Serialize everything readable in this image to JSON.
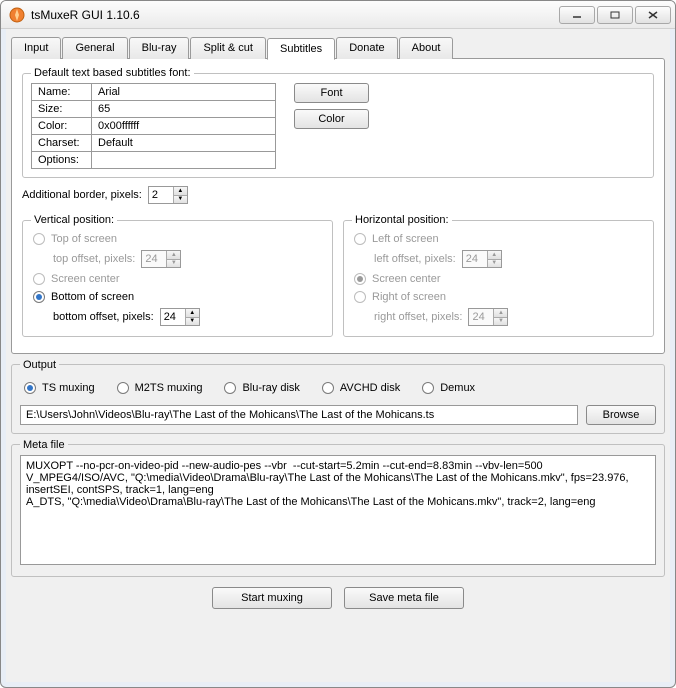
{
  "window": {
    "title": "tsMuxeR GUI 1.10.6"
  },
  "tabs": {
    "input": "Input",
    "general": "General",
    "bluray": "Blu-ray",
    "split": "Split & cut",
    "subtitles": "Subtitles",
    "donate": "Donate",
    "about": "About"
  },
  "subtitles": {
    "fieldset_label": "Default text based subtitles font:",
    "font_keys": {
      "name": "Name:",
      "size": "Size:",
      "color": "Color:",
      "charset": "Charset:",
      "options": "Options:"
    },
    "font_vals": {
      "name": "Arial",
      "size": "65",
      "color": "0x00ffffff",
      "charset": "Default",
      "options": ""
    },
    "btn_font": "Font",
    "btn_color": "Color",
    "add_border_label": "Additional border, pixels:",
    "add_border_val": "2",
    "vpos": {
      "legend": "Vertical position:",
      "top": "Top of screen",
      "top_off_lbl": "top offset, pixels:",
      "top_off_val": "24",
      "center": "Screen center",
      "bottom": "Bottom of screen",
      "bot_off_lbl": "bottom offset, pixels:",
      "bot_off_val": "24"
    },
    "hpos": {
      "legend": "Horizontal position:",
      "left": "Left of screen",
      "left_off_lbl": "left offset, pixels:",
      "left_off_val": "24",
      "center": "Screen center",
      "right": "Right of screen",
      "right_off_lbl": "right offset, pixels:",
      "right_off_val": "24"
    }
  },
  "output": {
    "legend": "Output",
    "opts": {
      "ts": "TS muxing",
      "m2ts": "M2TS muxing",
      "bluray": "Blu-ray disk",
      "avchd": "AVCHD disk",
      "demux": "Demux"
    },
    "path": "E:\\Users\\John\\Videos\\Blu-ray\\The Last of the Mohicans\\The Last of the Mohicans.ts",
    "browse": "Browse"
  },
  "meta": {
    "legend": "Meta file",
    "text": "MUXOPT --no-pcr-on-video-pid --new-audio-pes --vbr  --cut-start=5.2min --cut-end=8.83min --vbv-len=500\nV_MPEG4/ISO/AVC, \"Q:\\media\\Video\\Drama\\Blu-ray\\The Last of the Mohicans\\The Last of the Mohicans.mkv\", fps=23.976, insertSEI, contSPS, track=1, lang=eng\nA_DTS, \"Q:\\media\\Video\\Drama\\Blu-ray\\The Last of the Mohicans\\The Last of the Mohicans.mkv\", track=2, lang=eng"
  },
  "footer": {
    "start": "Start muxing",
    "save": "Save meta file"
  }
}
